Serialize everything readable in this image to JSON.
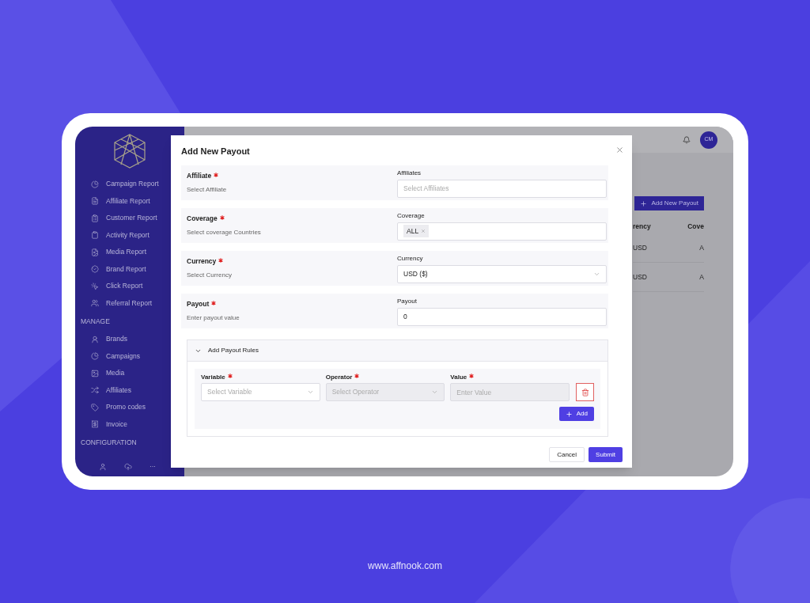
{
  "sidebar": {
    "groups": [
      {
        "items": [
          {
            "label": "Campaign Report"
          },
          {
            "label": "Affiliate Report"
          },
          {
            "label": "Customer Report"
          },
          {
            "label": "Activity Report"
          },
          {
            "label": "Media Report"
          },
          {
            "label": "Brand Report"
          },
          {
            "label": "Click Report"
          },
          {
            "label": "Referral Report"
          }
        ]
      },
      {
        "title": "MANAGE",
        "items": [
          {
            "label": "Brands"
          },
          {
            "label": "Campaigns"
          },
          {
            "label": "Media"
          },
          {
            "label": "Affiliates"
          },
          {
            "label": "Promo codes"
          },
          {
            "label": "Invoice"
          }
        ]
      },
      {
        "title": "CONFIGURATION"
      }
    ],
    "more": "···"
  },
  "header": {
    "avatar": "CM"
  },
  "page": {
    "add_button": "Add New Payout",
    "table": {
      "columns": [
        "rency",
        "Cove"
      ],
      "rows": [
        [
          "USD",
          "A"
        ],
        [
          "USD",
          "A"
        ]
      ]
    }
  },
  "modal": {
    "title": "Add New Payout",
    "fields": [
      {
        "kind": "input",
        "label": "Affiliate",
        "required": true,
        "hint": "Select Affiliate",
        "field_label": "Affiliates",
        "placeholder": "Select Affiliates"
      },
      {
        "kind": "tags",
        "label": "Coverage",
        "required": true,
        "hint": "Select coverage Countries",
        "field_label": "Coverage",
        "tags": [
          "ALL"
        ]
      },
      {
        "kind": "select",
        "label": "Currency",
        "required": true,
        "hint": "Select Currency",
        "field_label": "Currency",
        "value": "USD ($)"
      },
      {
        "kind": "input",
        "label": "Payout",
        "required": true,
        "hint": "Enter payout value",
        "field_label": "Payout",
        "value": "0"
      }
    ],
    "rules": {
      "title": "Add Payout Rules",
      "expanded": true,
      "fields": [
        {
          "kind": "select",
          "label": "Variable",
          "required": true,
          "placeholder": "Select Variable",
          "disabled": false
        },
        {
          "kind": "select",
          "label": "Operator",
          "required": true,
          "placeholder": "Select Operator",
          "disabled": true
        },
        {
          "kind": "input",
          "label": "Value",
          "required": true,
          "placeholder": "Enter Value",
          "disabled": true
        }
      ],
      "add_button": "Add"
    },
    "buttons": {
      "cancel": "Cancel",
      "submit": "Submit"
    }
  },
  "footer": {
    "url": "www.affnook.com"
  }
}
